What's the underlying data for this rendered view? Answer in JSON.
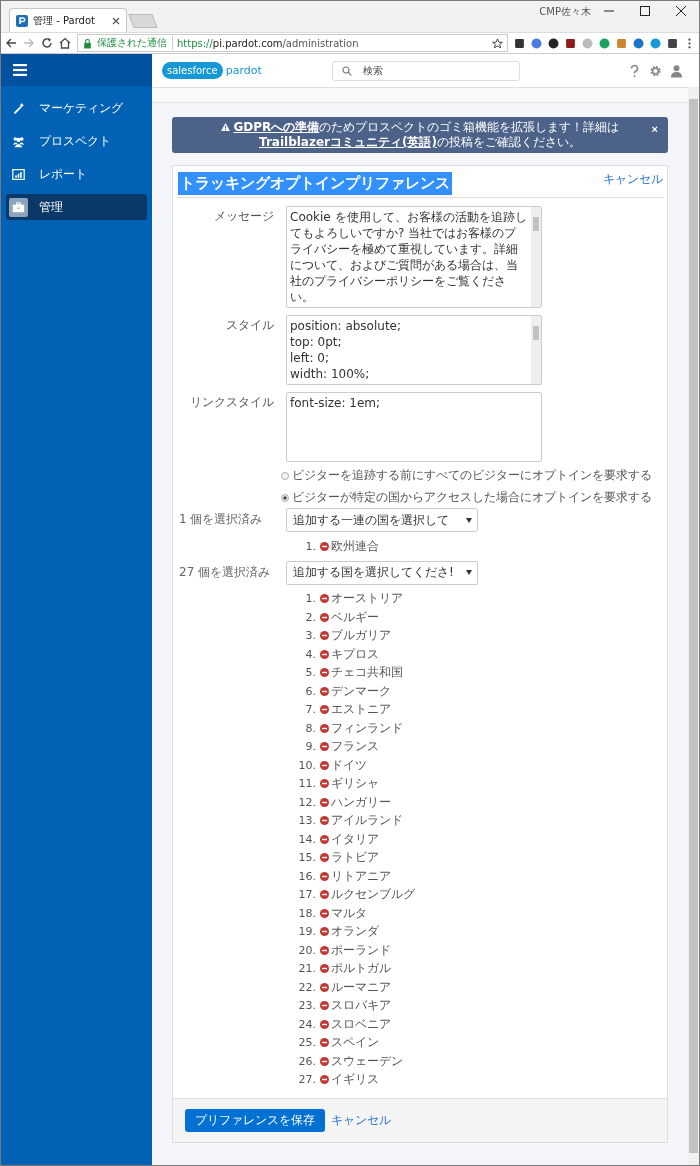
{
  "browser": {
    "tab_title": "管理 - Pardot",
    "profile": "CMP佐々木",
    "secure_label": "保護された通信",
    "url_scheme": "https://",
    "url_host": "pi.pardot.com",
    "url_path": "/administration"
  },
  "sidebar": {
    "items": [
      {
        "label": "マーケティング",
        "selected": false
      },
      {
        "label": "プロスペクト",
        "selected": false
      },
      {
        "label": "レポート",
        "selected": false
      },
      {
        "label": "管理",
        "selected": true
      }
    ]
  },
  "header": {
    "logo_cloud": "salesforce",
    "logo_product": "pardot",
    "search": {
      "placeholder": "検索"
    }
  },
  "banner": {
    "segments": [
      {
        "kind": "link",
        "text": "GDPRへの準備"
      },
      {
        "kind": "text",
        "text": "のためプロスペクトのゴミ箱機能を拡張します！詳細は"
      },
      {
        "kind": "link",
        "text": "Trailblazerコミュニティ(英語)"
      },
      {
        "kind": "text",
        "text": "の投稿をご確認ください。"
      }
    ],
    "close": "×"
  },
  "form": {
    "title": "トラッキングオプトインプリファレンス",
    "cancel_link": "キャンセル",
    "fields": [
      {
        "label": "メッセージ",
        "lines": [
          "Cookie を使用して、お客様の活動を追跡してもよろしいですか? 当社ではお客様のプライバシーを極めて重視しています。詳細について、およびご質問がある場合は、当社のプライバシーポリシーをご覧ください。"
        ],
        "scrollbar": true
      },
      {
        "label": "スタイル",
        "lines": [
          "position: absolute;",
          "top: 0pt;",
          "left: 0;",
          "width: 100%;"
        ],
        "scrollbar": true
      },
      {
        "label": "リンクスタイル",
        "lines": [
          "font-size: 1em;"
        ],
        "scrollbar": false
      }
    ],
    "radios": [
      {
        "label": "ビジターを追跡する前にすべてのビジターにオプトインを要求する",
        "selected": false
      },
      {
        "label": "ビジターが特定の国からアクセスした場合にオプトインを要求する",
        "selected": true
      }
    ],
    "selections": [
      {
        "count_label": "1 個を選択済み",
        "select": "追加する一連の国を選択して",
        "items": [
          {
            "number": "1.",
            "name": "欧州連合"
          }
        ]
      },
      {
        "count_label": "27 個を選択済み",
        "select": "追加する国を選択してくださ!",
        "items": [
          {
            "number": "1.",
            "name": "オーストリア"
          },
          {
            "number": "2.",
            "name": "ベルギー"
          },
          {
            "number": "3.",
            "name": "ブルガリア"
          },
          {
            "number": "4.",
            "name": "キプロス"
          },
          {
            "number": "5.",
            "name": "チェコ共和国"
          },
          {
            "number": "6.",
            "name": "デンマーク"
          },
          {
            "number": "7.",
            "name": "エストニア"
          },
          {
            "number": "8.",
            "name": "フィンランド"
          },
          {
            "number": "9.",
            "name": "フランス"
          },
          {
            "number": "10.",
            "name": "ドイツ"
          },
          {
            "number": "11.",
            "name": "ギリシャ"
          },
          {
            "number": "12.",
            "name": "ハンガリー"
          },
          {
            "number": "13.",
            "name": "アイルランド"
          },
          {
            "number": "14.",
            "name": "イタリア"
          },
          {
            "number": "15.",
            "name": "ラトビア"
          },
          {
            "number": "16.",
            "name": "リトアニア"
          },
          {
            "number": "17.",
            "name": "ルクセンブルグ"
          },
          {
            "number": "18.",
            "name": "マルタ"
          },
          {
            "number": "19.",
            "name": "オランダ"
          },
          {
            "number": "20.",
            "name": "ポーランド"
          },
          {
            "number": "21.",
            "name": "ポルトガル"
          },
          {
            "number": "22.",
            "name": "ルーマニア"
          },
          {
            "number": "23.",
            "name": "スロバキア"
          },
          {
            "number": "24.",
            "name": "スロベニア"
          },
          {
            "number": "25.",
            "name": "スペイン"
          },
          {
            "number": "26.",
            "name": "スウェーデン"
          },
          {
            "number": "27.",
            "name": "イギリス"
          }
        ]
      }
    ],
    "save_button": "プリファレンスを保存",
    "footer_cancel": "キャンセル"
  }
}
